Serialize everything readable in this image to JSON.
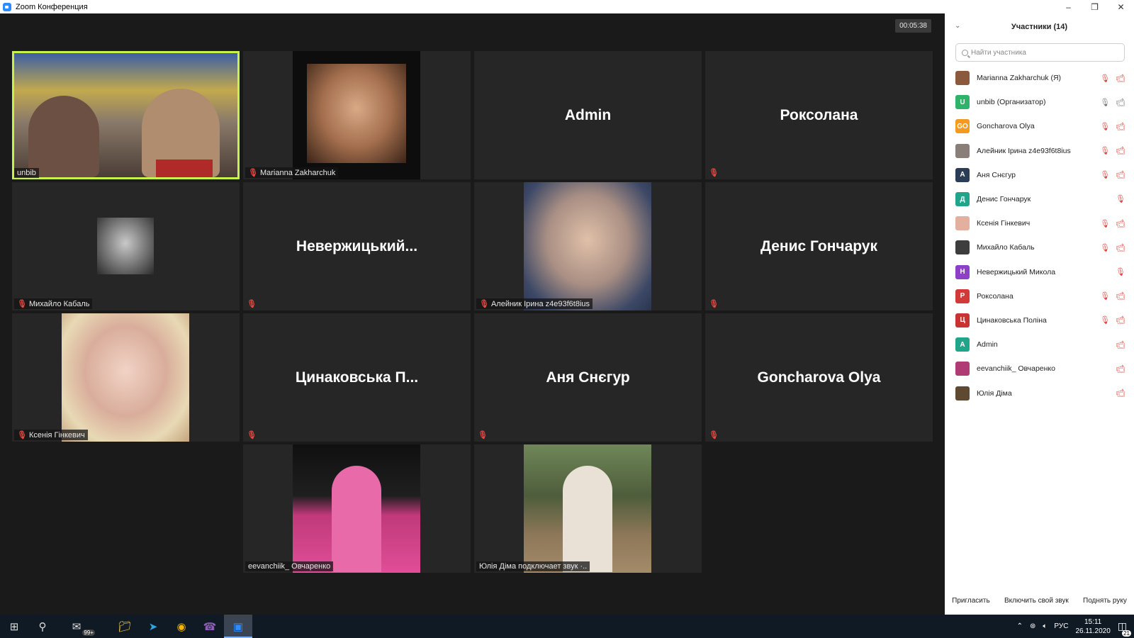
{
  "window": {
    "title": "Zoom Конференция"
  },
  "timer": "00:05:38",
  "tiles": [
    {
      "name": "unbib",
      "label": "unbib"
    },
    {
      "name": "marianna",
      "label": "Marianna Zakharchuk"
    },
    {
      "name": "admin",
      "bigname": "Admin"
    },
    {
      "name": "roksolana",
      "bigname": "Роксолана"
    },
    {
      "name": "mykhailo",
      "label": "Михайло Кабаль"
    },
    {
      "name": "neverzhytskyi",
      "bigname": "Невержицький..."
    },
    {
      "name": "aleinyk",
      "label": "Алейник Ірина z4e93f6t8ius"
    },
    {
      "name": "denys",
      "bigname": "Денис Гончарук"
    },
    {
      "name": "kseniia",
      "label": "Ксенія Гінкевич"
    },
    {
      "name": "tsynakovska",
      "bigname": "Цинаковська  П..."
    },
    {
      "name": "anya",
      "bigname": "Аня Снєгур"
    },
    {
      "name": "goncharova",
      "bigname": "Goncharova Olya"
    },
    {
      "name": "eevanchiik",
      "label": "eevanchiik_ Овчаренко"
    },
    {
      "name": "yuliia",
      "label": "Юлія Діма подключает звук ·.."
    }
  ],
  "panel": {
    "title": "Участники (14)",
    "search_placeholder": "Найти участника",
    "participants": [
      {
        "name": "Marianna Zakharchuk (Я)",
        "avatar": "",
        "color": "#8b5a3c",
        "photo": true,
        "mic": "muted",
        "cam": "off"
      },
      {
        "name": "unbib (Организатор)",
        "avatar": "U",
        "color": "#2fb36b",
        "mic": "on",
        "cam": "on"
      },
      {
        "name": "Goncharova Olya",
        "avatar": "GO",
        "color": "#f39a1f",
        "mic": "muted",
        "cam": "off"
      },
      {
        "name": "Алейник Ірина z4e93f6t8ius",
        "avatar": "",
        "color": "#8a7f78",
        "photo": true,
        "mic": "muted",
        "cam": "off"
      },
      {
        "name": "Аня Снєгур",
        "avatar": "А",
        "color": "#2b3c56",
        "mic": "muted",
        "cam": "off"
      },
      {
        "name": "Денис Гончарук",
        "avatar": "Д",
        "color": "#21a58a",
        "mic": "muted",
        "cam": "none"
      },
      {
        "name": "Ксенія Гінкевич",
        "avatar": "",
        "color": "#e3b0a0",
        "photo": true,
        "mic": "muted",
        "cam": "off"
      },
      {
        "name": "Михайло Кабаль",
        "avatar": "",
        "color": "#3d3d3d",
        "photo": true,
        "mic": "muted",
        "cam": "off"
      },
      {
        "name": "Невержицький Микола",
        "avatar": "Н",
        "color": "#8d3fc6",
        "mic": "muted",
        "cam": "none"
      },
      {
        "name": "Роксолана",
        "avatar": "Р",
        "color": "#d23a3a",
        "mic": "muted",
        "cam": "off"
      },
      {
        "name": "Цинаковська Поліна",
        "avatar": "Ц",
        "color": "#c83434",
        "mic": "muted",
        "cam": "off"
      },
      {
        "name": "Admin",
        "avatar": "A",
        "color": "#21a58a",
        "mic": "none",
        "cam": "off"
      },
      {
        "name": "eevanchiik_ Овчаренко",
        "avatar": "",
        "color": "#b03a74",
        "photo": true,
        "mic": "none",
        "cam": "off"
      },
      {
        "name": "Юлія Діма",
        "avatar": "",
        "color": "#5d4a30",
        "photo": true,
        "mic": "none",
        "cam": "off"
      }
    ],
    "footer": {
      "invite": "Пригласить",
      "unmute": "Включить свой звук",
      "raise_hand": "Поднять руку"
    }
  },
  "taskbar": {
    "mail_badge": "99+",
    "language": "РУС",
    "time": "15:11",
    "date": "26.11.2020",
    "notifications": "21"
  },
  "icons": {
    "mic_muted": "mic-muted-icon",
    "cam_off": "camera-off-icon",
    "mic_on": "mic-icon",
    "cam_on": "camera-icon"
  }
}
